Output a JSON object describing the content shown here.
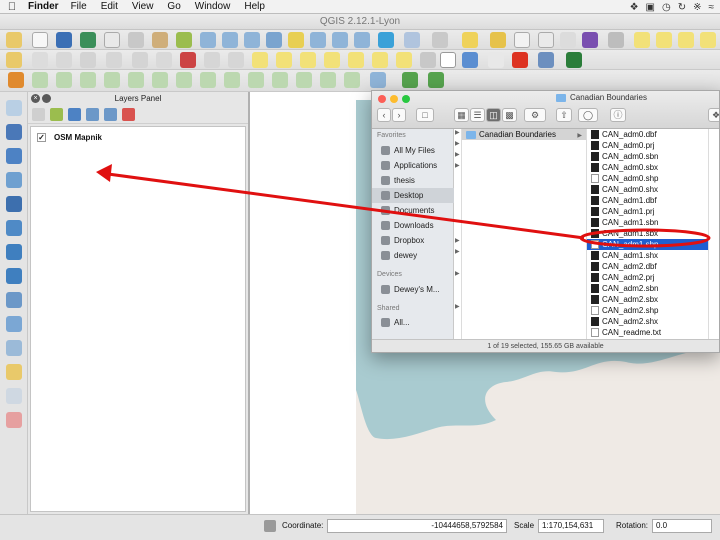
{
  "menubar": {
    "apple": "",
    "app_name": "Finder",
    "items": [
      "File",
      "Edit",
      "View",
      "Go",
      "Window",
      "Help"
    ]
  },
  "qgis": {
    "title": "QGIS 2.12.1-Lyon"
  },
  "layers_panel": {
    "title": "Layers Panel",
    "layers": [
      {
        "name": "OSM Mapnik",
        "checked": true,
        "check_glyph": "✓"
      }
    ]
  },
  "statusbar": {
    "coordinate_label": "Coordinate:",
    "coordinate_value": "-10444658,5792584",
    "scale_label": "Scale",
    "scale_value": "1:170,154,631",
    "rotation_label": "Rotation:",
    "rotation_value": "0.0"
  },
  "finder": {
    "title": "Canadian Boundaries",
    "back": "‹",
    "forward": "›",
    "sidebar": {
      "favorites_header": "Favorites",
      "favorites": [
        "All My Files",
        "Applications",
        "thesis",
        "Desktop",
        "Documents",
        "Downloads",
        "Dropbox",
        "dewey"
      ],
      "selected_favorite": "Desktop",
      "devices_header": "Devices",
      "devices": [
        "Dewey's M..."
      ],
      "shared_header": "Shared",
      "shared": [
        "All..."
      ]
    },
    "folder_column": [
      "Canadian Boundaries"
    ],
    "files": [
      "CAN_adm0.dbf",
      "CAN_adm0.prj",
      "CAN_adm0.sbn",
      "CAN_adm0.sbx",
      "CAN_adm0.shp",
      "CAN_adm0.shx",
      "CAN_adm1.dbf",
      "CAN_adm1.prj",
      "CAN_adm1.sbn",
      "CAN_adm1.sbx",
      "CAN_adm1.shp",
      "CAN_adm1.shx",
      "CAN_adm2.dbf",
      "CAN_adm2.prj",
      "CAN_adm2.sbn",
      "CAN_adm2.sbx",
      "CAN_adm2.shp",
      "CAN_adm2.shx",
      "CAN_readme.txt"
    ],
    "selected_file": "CAN_adm1.shp",
    "status": "1 of 19 selected, 155.65 GB available"
  },
  "colors": {
    "annotation_red": "#e01010",
    "selection_blue": "#1f5fd1",
    "water": "#a9cbd0",
    "land": "#efeae5"
  }
}
